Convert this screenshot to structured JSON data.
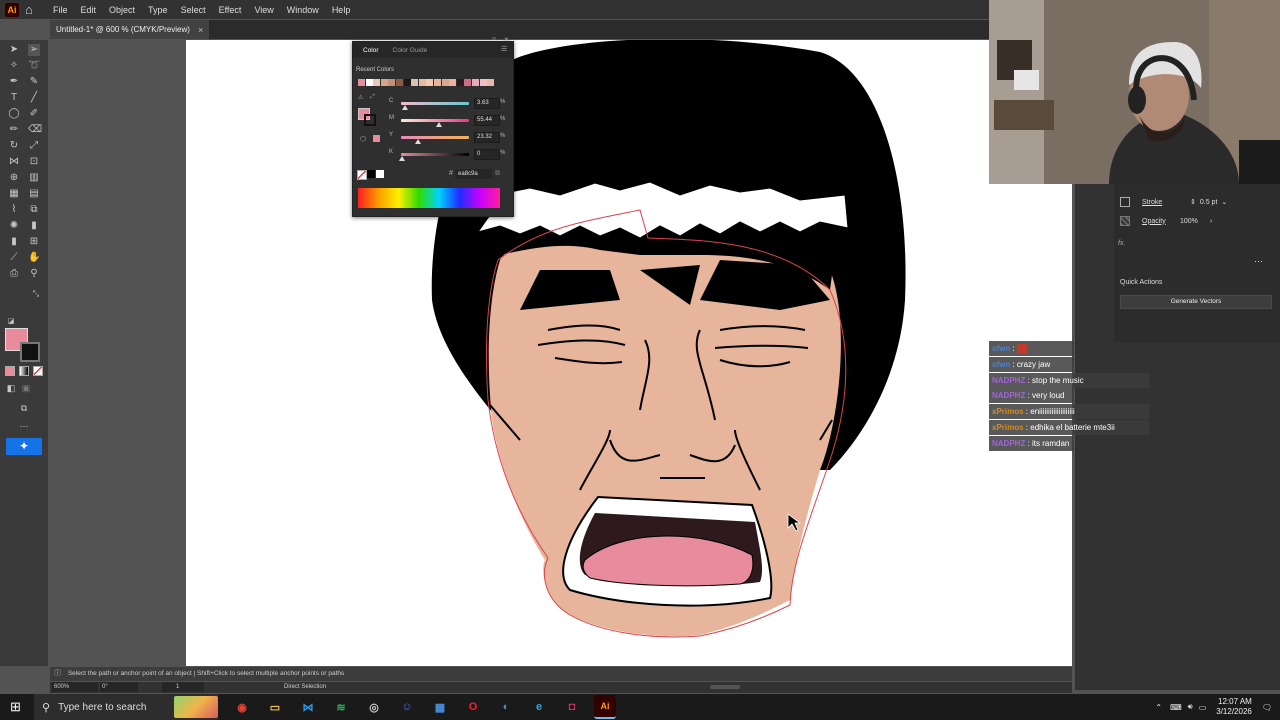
{
  "menu": {
    "app_logo": "Ai",
    "items": [
      "File",
      "Edit",
      "Object",
      "Type",
      "Select",
      "Effect",
      "View",
      "Window",
      "Help"
    ]
  },
  "document": {
    "tab_label": "Untitled-1* @ 600 % (CMYK/Preview)",
    "close_glyph": "×"
  },
  "color_panel": {
    "tabs": [
      "Color",
      "Color Guide"
    ],
    "recent_colors_label": "Recent Colors",
    "recent_colors": [
      "#e88b9c",
      "#ffffff",
      "#e8c8b8",
      "#d4a48c",
      "#c0907a",
      "#8e5a48",
      "#1a1a1a",
      "#d9c2b5",
      "#e9b8a4",
      "#f2c9b4",
      "#e7b49c",
      "#d8a890",
      "#efb1a0",
      "#2e1a1d",
      "#cc6d86",
      "#e8a8b8",
      "#f0c0c8",
      "#e6b8a9"
    ],
    "sliders": [
      {
        "label": "C",
        "value": "3.63",
        "unit": "%",
        "fraction": 0.04,
        "gradient": "linear-gradient(90deg,#f3bcc6,#67c7d6)"
      },
      {
        "label": "M",
        "value": "55.44",
        "unit": "%",
        "fraction": 0.55,
        "gradient": "linear-gradient(90deg,#f9f0d5,#e8358a)"
      },
      {
        "label": "Y",
        "value": "23.32",
        "unit": "%",
        "fraction": 0.23,
        "gradient": "linear-gradient(90deg,#e88bc0,#f2b04e)"
      },
      {
        "label": "K",
        "value": "0",
        "unit": "%",
        "fraction": 0.0,
        "gradient": "linear-gradient(90deg,#e88b9c,#000000)"
      }
    ],
    "hex_symbol": "#",
    "hex_value": "ea8c9a",
    "fill_color": "#e88b9c"
  },
  "properties": {
    "stroke_label": "Stroke",
    "stroke_value": "0.5 pt",
    "opacity_label": "Opacity",
    "opacity_value": "100%",
    "fx_label": "fx.",
    "quick_actions_label": "Quick Actions",
    "generate_button": "Generate Vectors"
  },
  "chat": [
    {
      "user": "sfwn",
      "msg": "",
      "user_color": "#4a7fd6",
      "emote": true
    },
    {
      "user": "sfwn",
      "msg": "crazy jaw",
      "user_color": "#4a7fd6",
      "emote": false
    },
    {
      "user": "NADPHZ",
      "msg": "stop the music",
      "user_color": "#a066d8",
      "emote": false
    },
    {
      "user": "NADPHZ",
      "msg": "very loud",
      "user_color": "#a066d8",
      "emote": false
    },
    {
      "user": "xPrimos",
      "msg": "eniiiiiiiiiiiiiiiiiiii",
      "user_color": "#d98c1e",
      "emote": false
    },
    {
      "user": "xPrimos",
      "msg": "edhika el batterie mte3ii",
      "user_color": "#d98c1e",
      "emote": false
    },
    {
      "user": "NADPHZ",
      "msg": "its ramdan",
      "user_color": "#a066d8",
      "emote": false
    }
  ],
  "status": {
    "hint": "Select the path or anchor point of an object  |  Shift+Click to select multiple anchor points or paths",
    "zoom": "600%",
    "rotation": "0°",
    "artboard_index": "1",
    "tool_name": "Direct Selection"
  },
  "taskbar": {
    "search_placeholder": "Type here to search",
    "time": "12:07 AM",
    "date": "3/12/2026",
    "apps": [
      {
        "name": "chrome",
        "color": "#e34234",
        "glyph": "◉"
      },
      {
        "name": "file-explorer",
        "color": "#f5c242",
        "glyph": "▭"
      },
      {
        "name": "vscode",
        "color": "#2d9ae8",
        "glyph": "⋈"
      },
      {
        "name": "spotify",
        "color": "#1db954",
        "glyph": "≋"
      },
      {
        "name": "obs",
        "color": "#cccccc",
        "glyph": "◎"
      },
      {
        "name": "discord",
        "color": "#5865f2",
        "glyph": "☺"
      },
      {
        "name": "store",
        "color": "#4a90e2",
        "glyph": "▦"
      },
      {
        "name": "opera",
        "color": "#ff1b2d",
        "glyph": "O"
      },
      {
        "name": "steam",
        "color": "#4f8fc9",
        "glyph": "◐"
      },
      {
        "name": "edge",
        "color": "#34a6e0",
        "glyph": "e"
      },
      {
        "name": "instagram",
        "color": "#e1306c",
        "glyph": "◘"
      },
      {
        "name": "illustrator",
        "color": "#ff9a00",
        "glyph": "Ai"
      }
    ]
  }
}
